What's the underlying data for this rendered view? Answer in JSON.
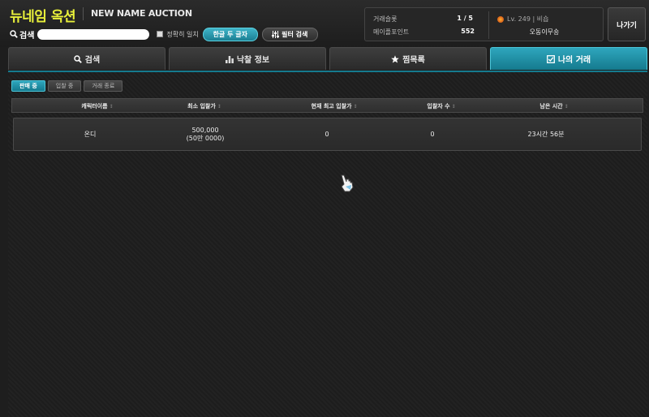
{
  "header": {
    "title": "뉴네임 옥션",
    "subtitle": "NEW NAME AUCTION",
    "search_label": "검색",
    "search_value": "",
    "exact_match_label": "정확히 일치",
    "korean_two_chars_label": "한글 두 글자",
    "filter_search_label": "필터 검색"
  },
  "stats": {
    "slots_label": "거래슬롯",
    "slots_value": "1 / 5",
    "points_label": "메이플포인트",
    "points_value": "552",
    "level_text": "Lv. 249 | 비숍",
    "character_name": "오동이무숑"
  },
  "exit_label": "나가기",
  "tabs": [
    {
      "label": "검색",
      "icon": "search-icon"
    },
    {
      "label": "낙찰 정보",
      "icon": "bar-chart-icon"
    },
    {
      "label": "찜목록",
      "icon": "star-icon"
    },
    {
      "label": "나의 거래",
      "icon": "checkbox-icon",
      "active": true
    }
  ],
  "subtabs": [
    {
      "label": "판매 중",
      "active": true
    },
    {
      "label": "입찰 중"
    },
    {
      "label": "거래 종료"
    }
  ],
  "table": {
    "columns": [
      "캐릭터이름",
      "최소 입찰가",
      "현재 최고 입찰가",
      "입찰자 수",
      "남은 시간"
    ],
    "rows": [
      {
        "name": "온디",
        "min_bid": "500,000",
        "min_bid_sub": "(50만 0000)",
        "current_bid": "0",
        "bidders": "0",
        "remaining": "23시간 56분"
      }
    ]
  },
  "colors": {
    "accent": "#1e8fa4",
    "title_yellow": "#e8f03a"
  }
}
